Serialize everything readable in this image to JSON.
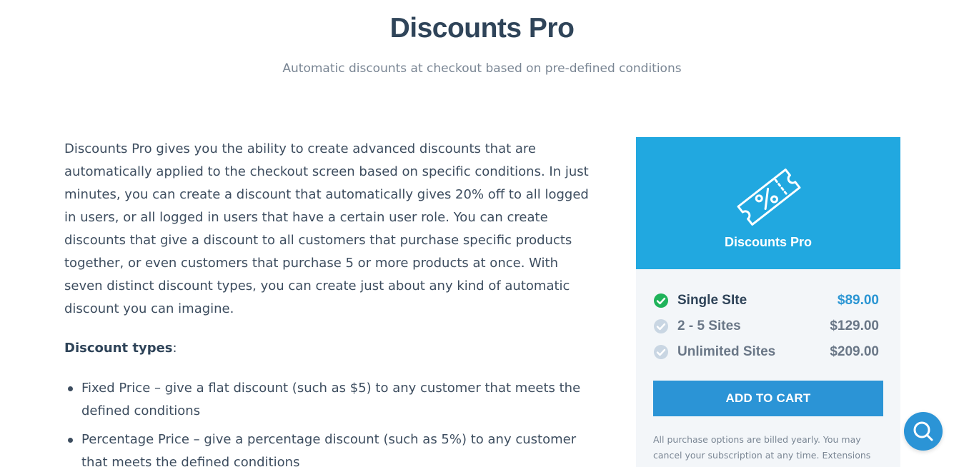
{
  "header": {
    "title": "Discounts Pro",
    "subtitle": "Automatic discounts at checkout based on pre-defined conditions"
  },
  "main": {
    "description": "Discounts Pro gives you the ability to create advanced discounts that are automatically applied to the checkout screen based on specific conditions. In just minutes, you can create a discount that automatically gives 20% off to all logged in users, or all logged in users that have a certain user role. You can create discounts that give a discount to all customers that purchase specific products together, or even customers that purchase 5 or more products at once. With seven distinct discount types, you can create just about any kind of automatic discount you can imagine.",
    "types_label": "Discount types",
    "types_colon": ":",
    "types": [
      "Fixed Price – give a flat discount (such as $5) to any customer that meets the defined conditions",
      "Percentage Price –  give a percentage discount (such as 5%) to any customer that meets the defined conditions"
    ]
  },
  "card": {
    "name": "Discounts Pro",
    "icon": "discount-ticket-icon",
    "accent_color": "#21a8e0",
    "options": [
      {
        "name": "Single SIte",
        "price": "$89.00",
        "selected": true
      },
      {
        "name": "2 - 5 Sites",
        "price": "$129.00",
        "selected": false
      },
      {
        "name": "Unlimited Sites",
        "price": "$209.00",
        "selected": false
      }
    ],
    "add_to_cart": "ADD TO CART",
    "billing_note": "All purchase options are billed yearly. You may cancel your subscription at any time. Extensions subject to yearly license for support and updates."
  },
  "help": {
    "icon": "search-help-icon"
  }
}
